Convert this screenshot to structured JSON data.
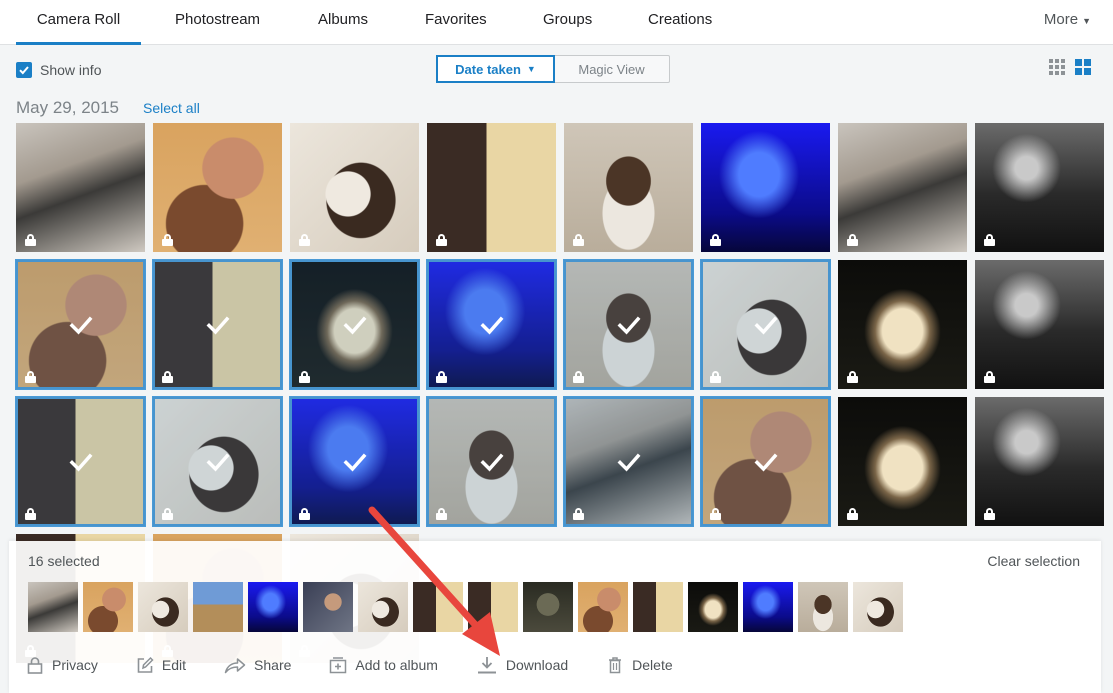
{
  "tabs": [
    {
      "label": "Camera Roll",
      "active": true
    },
    {
      "label": "Photostream"
    },
    {
      "label": "Albums"
    },
    {
      "label": "Favorites"
    },
    {
      "label": "Groups"
    },
    {
      "label": "Creations"
    }
  ],
  "more_label": "More",
  "show_info": {
    "label": "Show info",
    "checked": true
  },
  "view_toggle": {
    "date_taken": "Date taken",
    "magic_view": "Magic View",
    "active": "date_taken"
  },
  "date_group": {
    "date": "May 29, 2015",
    "select_all": "Select all"
  },
  "photo_subjects": [
    "gym",
    "selfie-dog",
    "dog-lying",
    "man-magazine",
    "puppy",
    "concert-blue",
    "gym",
    "concert-dark",
    "selfie-dog",
    "man-magazine",
    "buddha",
    "concert-blue",
    "puppy",
    "dog-lying",
    "buddha",
    "concert-dark",
    "man-magazine",
    "dog-lying",
    "concert-blue",
    "puppy",
    "gym",
    "selfie-dog",
    "buddha",
    "concert-dark"
  ],
  "selected_photos": [
    8,
    9,
    10,
    11,
    12,
    13,
    16,
    17,
    18,
    19,
    20,
    21
  ],
  "tray": {
    "count_label": "16 selected",
    "clear_label": "Clear selection",
    "thumb_subjects": [
      "gym",
      "selfie-dog",
      "dog-lying",
      "landscape",
      "concert-blue",
      "man-laptop",
      "dog-lying",
      "man-magazine",
      "man-magazine",
      "zombie",
      "selfie-dog",
      "man-magazine",
      "buddha",
      "concert-blue",
      "puppy",
      "dog-lying"
    ],
    "actions": [
      {
        "label": "Privacy",
        "icon": "lock-icon"
      },
      {
        "label": "Edit",
        "icon": "edit-icon"
      },
      {
        "label": "Share",
        "icon": "share-icon"
      },
      {
        "label": "Add to album",
        "icon": "add-to-album-icon"
      },
      {
        "label": "Download",
        "icon": "download-icon"
      },
      {
        "label": "Delete",
        "icon": "trash-icon"
      }
    ]
  },
  "colors": {
    "accent": "#1a7fc6",
    "annotation_arrow": "#e8463d"
  }
}
